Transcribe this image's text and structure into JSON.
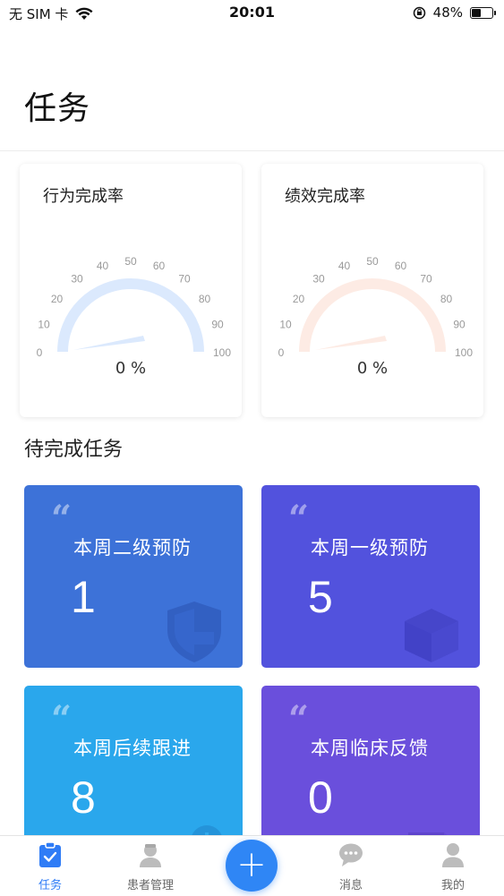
{
  "status_bar": {
    "carrier": "无 SIM 卡",
    "time": "20:01",
    "battery": "48%",
    "battery_level": 0.48
  },
  "page": {
    "title": "任务"
  },
  "gauges": [
    {
      "title": "行为完成率",
      "value": "0 %",
      "ticks": [
        "0",
        "10",
        "20",
        "30",
        "40",
        "50",
        "60",
        "70",
        "80",
        "90",
        "100"
      ],
      "color": "#dbe9fd"
    },
    {
      "title": "绩效完成率",
      "value": "0 %",
      "ticks": [
        "0",
        "10",
        "20",
        "30",
        "40",
        "50",
        "60",
        "70",
        "80",
        "90",
        "100"
      ],
      "color": "#fdebe4"
    }
  ],
  "pending": {
    "title": "待完成任务",
    "cards": [
      {
        "label": "本周二级预防",
        "count": "1",
        "color": "#3d72d8",
        "icon": "shield-icon"
      },
      {
        "label": "本周一级预防",
        "count": "5",
        "color": "#5252dd",
        "icon": "cube-icon"
      },
      {
        "label": "本周后续跟进",
        "count": "8",
        "color": "#2aa7ec",
        "icon": "schedule-icon"
      },
      {
        "label": "本周临床反馈",
        "count": "0",
        "color": "#6a4fdc",
        "icon": "document-icon"
      }
    ]
  },
  "tabs": [
    {
      "label": "任务",
      "icon": "clipboard-icon",
      "active": true
    },
    {
      "label": "患者管理",
      "icon": "patient-icon",
      "active": false
    },
    {
      "label": "",
      "icon": "plus-icon",
      "active": false
    },
    {
      "label": "消息",
      "icon": "chat-icon",
      "active": false
    },
    {
      "label": "我的",
      "icon": "user-icon",
      "active": false
    }
  ],
  "fab": {
    "label": "+"
  }
}
